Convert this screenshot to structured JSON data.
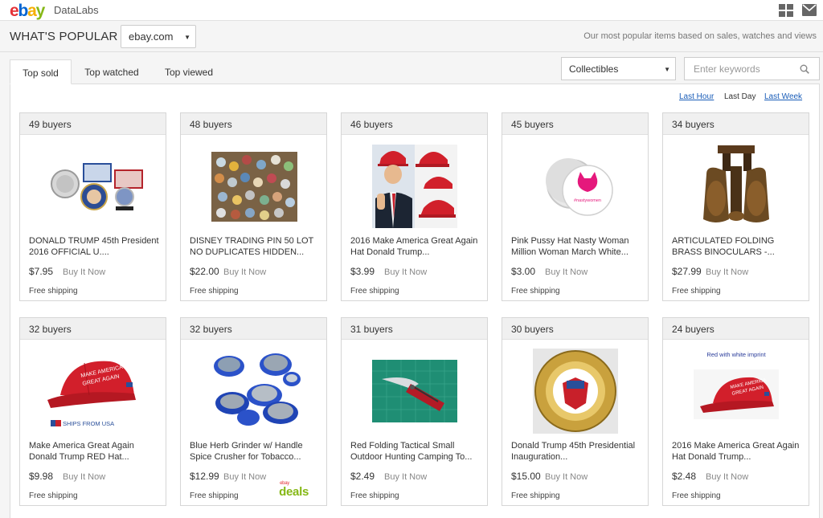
{
  "brand": {
    "logo_letters": [
      "e",
      "b",
      "a",
      "y"
    ],
    "product": "DataLabs"
  },
  "colors": {
    "ebay_red": "#e53238",
    "ebay_blue": "#0064d2",
    "ebay_yellow": "#f5af02",
    "ebay_green": "#86b817",
    "link": "#1a5db8"
  },
  "header": {
    "title": "WHAT'S POPULAR",
    "site_select": "ebay.com",
    "subtitle": "Our most popular items based on sales, watches and views"
  },
  "tabs": [
    {
      "label": "Top sold",
      "active": true
    },
    {
      "label": "Top watched",
      "active": false
    },
    {
      "label": "Top viewed",
      "active": false
    }
  ],
  "category_select": "Collectibles",
  "search": {
    "placeholder": "Enter keywords",
    "value": ""
  },
  "time_filters": [
    {
      "label": "Last Hour",
      "active": false
    },
    {
      "label": "Last Day",
      "active": true
    },
    {
      "label": "Last Week",
      "active": false
    }
  ],
  "items": [
    {
      "buyers": "49 buyers",
      "title": "DONALD TRUMP 45th President 2016 OFFICIAL U....",
      "price": "$7.95",
      "format": "Buy It Now",
      "shipping": "Free shipping",
      "image": "trump-coins"
    },
    {
      "buyers": "48 buyers",
      "title": "DISNEY TRADING PIN 50 LOT NO DUPLICATES HIDDEN...",
      "price": "$22.00",
      "format": "Buy It Now",
      "shipping": "Free shipping",
      "image": "disney-pins"
    },
    {
      "buyers": "46 buyers",
      "title": "2016 Make America Great Again Hat Donald Trump...",
      "price": "$3.99",
      "format": "Buy It Now",
      "shipping": "Free shipping",
      "image": "trump-hats"
    },
    {
      "buyers": "45 buyers",
      "title": "Pink Pussy Hat Nasty Woman Million Woman March White...",
      "price": "$3.00",
      "format": "Buy It Now",
      "shipping": "Free shipping",
      "image": "pin-button",
      "image_text": "#nastywomen"
    },
    {
      "buyers": "34 buyers",
      "title": "ARTICULATED FOLDING BRASS BINOCULARS -...",
      "price": "$27.99",
      "format": "Buy It Now",
      "shipping": "Free shipping",
      "image": "brass-binoculars"
    },
    {
      "buyers": "32 buyers",
      "title": "Make America Great Again Donald Trump RED Hat...",
      "price": "$9.98",
      "format": "Buy It Now",
      "shipping": "Free shipping",
      "image": "red-hat",
      "image_text": "SHIPS FROM USA"
    },
    {
      "buyers": "32 buyers",
      "title": "Blue Herb Grinder w/ Handle Spice Crusher for Tobacco...",
      "price": "$12.99",
      "format": "Buy It Now",
      "shipping": "Free shipping",
      "image": "herb-grinder",
      "badge": "deals",
      "badge_small": "ebay"
    },
    {
      "buyers": "31 buyers",
      "title": "Red Folding Tactical Small Outdoor Hunting Camping To...",
      "price": "$2.49",
      "format": "Buy It Now",
      "shipping": "Free shipping",
      "image": "folding-knife"
    },
    {
      "buyers": "30 buyers",
      "title": "Donald Trump 45th Presidential Inauguration...",
      "price": "$15.00",
      "format": "Buy It Now",
      "shipping": "Free shipping",
      "image": "inauguration-coin"
    },
    {
      "buyers": "24 buyers",
      "title": "2016 Make America Great Again Hat Donald Trump...",
      "price": "$2.48",
      "format": "Buy It Now",
      "shipping": "Free shipping",
      "image": "red-hat-white",
      "image_text": "Red with white imprint"
    }
  ]
}
